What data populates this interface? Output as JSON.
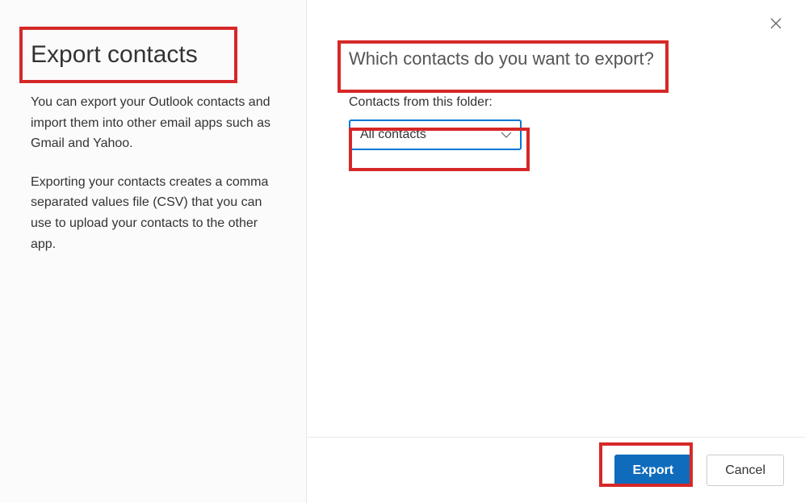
{
  "left": {
    "title": "Export contacts",
    "description1": "You can export your Outlook contacts and import them into other email apps such as Gmail and Yahoo.",
    "description2": "Exporting your contacts creates a comma separated values file (CSV) that you can use to upload your contacts to the other app."
  },
  "right": {
    "question": "Which contacts do you want to export?",
    "folder_label": "Contacts from this folder:",
    "selected_value": "All contacts"
  },
  "footer": {
    "export_label": "Export",
    "cancel_label": "Cancel"
  }
}
